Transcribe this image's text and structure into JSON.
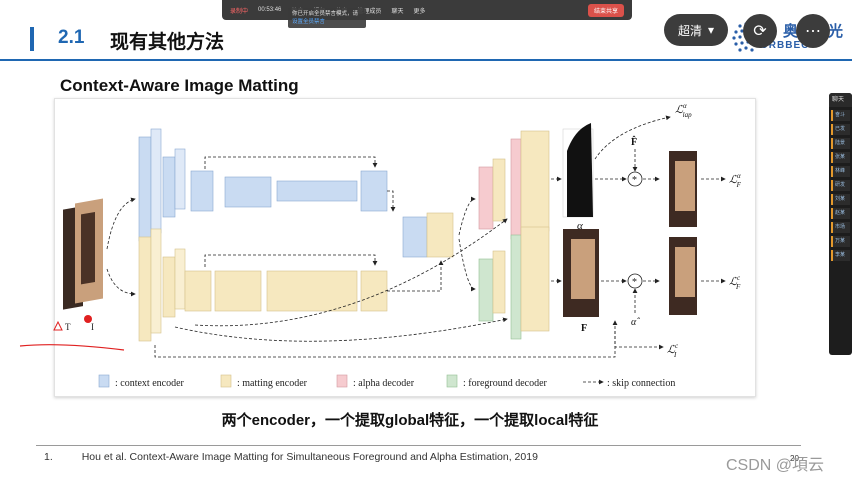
{
  "meeting_toolbar": {
    "recording_label": "录制中",
    "timer": "00:53:46",
    "items": [
      "静音",
      "视频",
      "共享",
      "管理成员",
      "聊天",
      "更多"
    ],
    "stop_share_label": "结束共享",
    "toast_line1": "你已开启全员禁言模式，请",
    "toast_link": "设置全员禁言"
  },
  "slide": {
    "section_number": "2.1",
    "section_title": "现有其他方法",
    "subtitle": "Context-Aware Image Matting",
    "caption": "两个encoder，一个提取global特征，一个提取local特征",
    "reference_number": "1.",
    "reference_text": "Hou et al. Context-Aware Image Matting for Simultaneous Foreground and Alpha Estimation, 2019",
    "page_number": "20"
  },
  "logo": {
    "brand_cn": "奥比中光",
    "brand_en": "ORBBEC"
  },
  "viewer_controls": {
    "quality_label": "超清",
    "quality_icon": "chevron-down-icon",
    "rotate_icon": "rotate-icon",
    "more_icon": "more-dots-icon"
  },
  "watermark": {
    "text": "CSDN @項云"
  },
  "figure": {
    "legend": {
      "context_encoder": ": context encoder",
      "matting_encoder": ": matting encoder",
      "alpha_decoder": ": alpha decoder",
      "foreground_decoder": ": foreground decoder",
      "skip_connection": ": skip connection"
    },
    "input_labels": {
      "t": "T",
      "i": "I"
    },
    "alpha_label": "α",
    "f_label": "F",
    "f_hat": "F̂",
    "alpha_hat": "α̂",
    "operator": "*",
    "loss_lap": "ℒ",
    "loss_lap_sup": "α",
    "loss_lap_sub": "lap",
    "loss_f": "ℒ",
    "loss_f_sup": "α",
    "loss_f_sub": "F",
    "loss_fc": "ℒ",
    "loss_fc_sup": "c",
    "loss_fc_sub": "F",
    "loss_i": "ℒ",
    "loss_i_sup": "c",
    "loss_i_sub": "I",
    "colors": {
      "context": "#c9dbf2",
      "matting": "#f6e8bf",
      "alpha": "#f6cbcf",
      "foreground": "#cfe6cf"
    }
  },
  "right_panel": {
    "header": "聊天",
    "items": [
      "奋斗",
      "已发",
      "陆景",
      "张某",
      "林峰",
      "研发",
      "刘某",
      "赵某",
      "市场",
      "万某",
      "李某"
    ]
  }
}
